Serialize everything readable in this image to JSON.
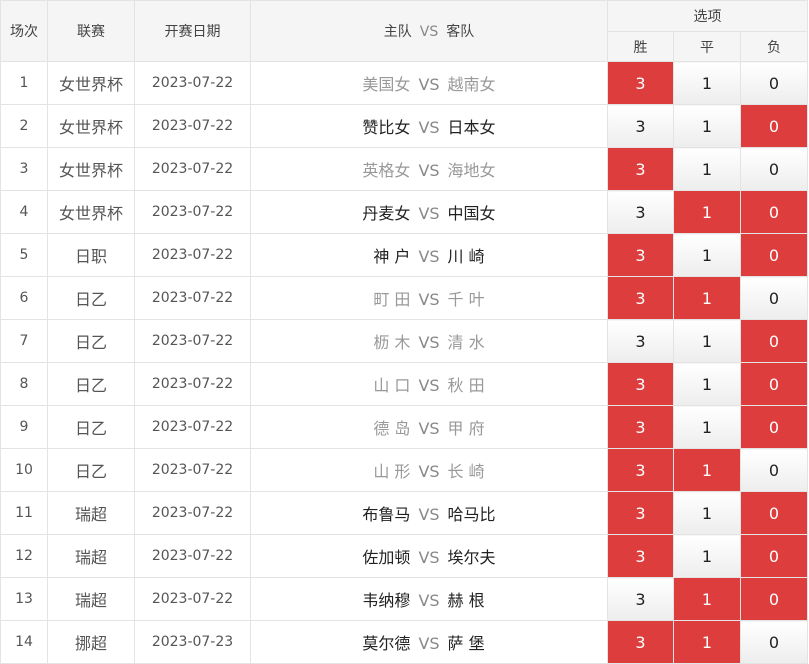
{
  "headers": {
    "round": "场次",
    "league": "联赛",
    "date": "开赛日期",
    "home": "主队",
    "vs": "VS",
    "away": "客队",
    "options": "选项",
    "win": "胜",
    "draw": "平",
    "lose": "负"
  },
  "colors": {
    "selected": "#dd3d3d",
    "muted_team": "#999999",
    "dark_team": "#222222"
  },
  "rows": [
    {
      "n": "1",
      "league": "女世界杯",
      "date": "2023-07-22",
      "home": "美国女",
      "away": "越南女",
      "w": "3",
      "d": "1",
      "l": "0",
      "sel": [
        true,
        false,
        false
      ],
      "muted": true
    },
    {
      "n": "2",
      "league": "女世界杯",
      "date": "2023-07-22",
      "home": "赞比女",
      "away": "日本女",
      "w": "3",
      "d": "1",
      "l": "0",
      "sel": [
        false,
        false,
        true
      ],
      "muted": false
    },
    {
      "n": "3",
      "league": "女世界杯",
      "date": "2023-07-22",
      "home": "英格女",
      "away": "海地女",
      "w": "3",
      "d": "1",
      "l": "0",
      "sel": [
        true,
        false,
        false
      ],
      "muted": true
    },
    {
      "n": "4",
      "league": "女世界杯",
      "date": "2023-07-22",
      "home": "丹麦女",
      "away": "中国女",
      "w": "3",
      "d": "1",
      "l": "0",
      "sel": [
        false,
        true,
        true
      ],
      "muted": false
    },
    {
      "n": "5",
      "league": "日职",
      "date": "2023-07-22",
      "home": "神 户",
      "away": "川 崎",
      "w": "3",
      "d": "1",
      "l": "0",
      "sel": [
        true,
        false,
        true
      ],
      "muted": false
    },
    {
      "n": "6",
      "league": "日乙",
      "date": "2023-07-22",
      "home": "町 田",
      "away": "千 叶",
      "w": "3",
      "d": "1",
      "l": "0",
      "sel": [
        true,
        true,
        false
      ],
      "muted": true
    },
    {
      "n": "7",
      "league": "日乙",
      "date": "2023-07-22",
      "home": "枥 木",
      "away": "清 水",
      "w": "3",
      "d": "1",
      "l": "0",
      "sel": [
        false,
        false,
        true
      ],
      "muted": true
    },
    {
      "n": "8",
      "league": "日乙",
      "date": "2023-07-22",
      "home": "山 口",
      "away": "秋 田",
      "w": "3",
      "d": "1",
      "l": "0",
      "sel": [
        true,
        false,
        true
      ],
      "muted": true
    },
    {
      "n": "9",
      "league": "日乙",
      "date": "2023-07-22",
      "home": "德 岛",
      "away": "甲 府",
      "w": "3",
      "d": "1",
      "l": "0",
      "sel": [
        true,
        false,
        true
      ],
      "muted": true
    },
    {
      "n": "10",
      "league": "日乙",
      "date": "2023-07-22",
      "home": "山 形",
      "away": "长 崎",
      "w": "3",
      "d": "1",
      "l": "0",
      "sel": [
        true,
        true,
        false
      ],
      "muted": true
    },
    {
      "n": "11",
      "league": "瑞超",
      "date": "2023-07-22",
      "home": "布鲁马",
      "away": "哈马比",
      "w": "3",
      "d": "1",
      "l": "0",
      "sel": [
        true,
        false,
        true
      ],
      "muted": false
    },
    {
      "n": "12",
      "league": "瑞超",
      "date": "2023-07-22",
      "home": "佐加顿",
      "away": "埃尔夫",
      "w": "3",
      "d": "1",
      "l": "0",
      "sel": [
        true,
        false,
        true
      ],
      "muted": false
    },
    {
      "n": "13",
      "league": "瑞超",
      "date": "2023-07-22",
      "home": "韦纳穆",
      "away": "赫 根",
      "w": "3",
      "d": "1",
      "l": "0",
      "sel": [
        false,
        true,
        true
      ],
      "muted": false
    },
    {
      "n": "14",
      "league": "挪超",
      "date": "2023-07-23",
      "home": "莫尔德",
      "away": "萨 堡",
      "w": "3",
      "d": "1",
      "l": "0",
      "sel": [
        true,
        true,
        false
      ],
      "muted": false
    }
  ]
}
